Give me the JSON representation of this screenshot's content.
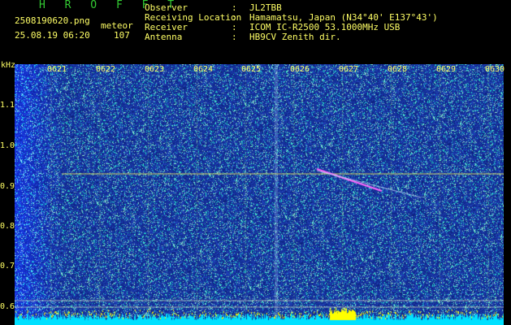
{
  "header": {
    "brand": "H R O F F T",
    "filename": "2508190620.png",
    "datetime": "25.08.19 06:20",
    "meteor_label": "meteor",
    "meteor_count": "107",
    "fields": [
      {
        "key": "Observer",
        "value": "JL2TBB"
      },
      {
        "key": "Receiving Location",
        "value": "Hamamatsu, Japan (N34°40' E137°43')"
      },
      {
        "key": "Receiver",
        "value": "ICOM IC-R2500 53.1000MHz USB"
      },
      {
        "key": "Antenna",
        "value": "HB9CV Zenith dir."
      }
    ]
  },
  "y_axis": {
    "unit": "kHz",
    "ticks": [
      "1.1",
      "1.0",
      "0.9",
      "0.8",
      "0.7",
      "0.6"
    ]
  },
  "x_axis": {
    "ticks": [
      "0621",
      "0622",
      "0623",
      "0624",
      "0625",
      "0626",
      "0627",
      "0628",
      "0629",
      "0630"
    ]
  },
  "colors": {
    "background": "#1a2a9a",
    "text": "#ffff66",
    "brand": "#33cc33",
    "carrier": "#d8d860",
    "meteor": "#ff66ff"
  }
}
